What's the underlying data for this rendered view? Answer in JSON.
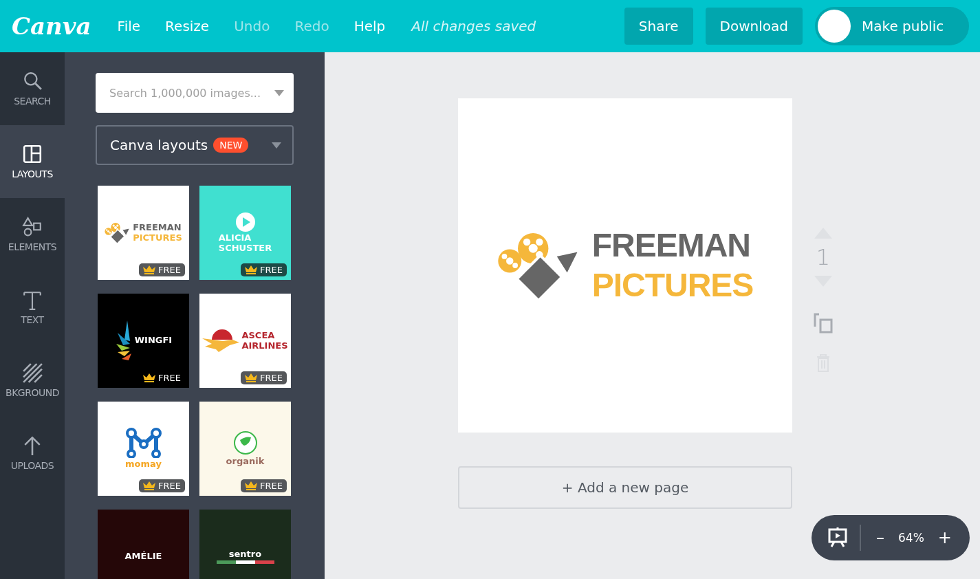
{
  "topbar": {
    "logo": "Canva",
    "menu": [
      {
        "label": "File",
        "disabled": false
      },
      {
        "label": "Resize",
        "disabled": false
      },
      {
        "label": "Undo",
        "disabled": true
      },
      {
        "label": "Redo",
        "disabled": true
      },
      {
        "label": "Help",
        "disabled": false
      }
    ],
    "status": "All changes saved",
    "buttons": [
      "Share",
      "Download"
    ],
    "toggle": {
      "label": "Make public",
      "on": false
    }
  },
  "sidebar": {
    "items": [
      {
        "label": "SEARCH",
        "selected": false
      },
      {
        "label": "LAYOUTS",
        "selected": true
      },
      {
        "label": "ELEMENTS",
        "selected": false
      },
      {
        "label": "TEXT",
        "selected": false
      },
      {
        "label": "BKGROUND",
        "selected": false
      },
      {
        "label": "UPLOADS",
        "selected": false
      }
    ]
  },
  "panel": {
    "search": {
      "placeholder": "Search 1,000,000 images..."
    },
    "dropdown": {
      "label": "Canva layouts",
      "badge": "NEW"
    },
    "templates": [
      {
        "kind": "film",
        "color": "#ffffff",
        "lines": [
          {
            "text": "FREEMAN",
            "color": "#666666"
          },
          {
            "text": "PICTURES",
            "color": "#f5b73b"
          }
        ],
        "badge": {
          "label": "FREE",
          "kind": "grey"
        }
      },
      {
        "kind": "play",
        "color": "#40e0d0",
        "lines": [
          {
            "text": "ALICIA",
            "color": "#ffffff"
          },
          {
            "text": "SCHUSTER",
            "color": "#ffffff"
          }
        ],
        "badge": {
          "label": "FREE",
          "kind": "dark"
        }
      },
      {
        "kind": "wing",
        "color": "#000000",
        "lines": [
          {
            "text": "WINGFI",
            "color": "#ffffff"
          }
        ],
        "badge": {
          "label": "FREE",
          "kind": "plain"
        }
      },
      {
        "kind": "bird",
        "color": "#ffffff",
        "lines": [
          {
            "text": "ASCEA",
            "color": "#b5262e"
          },
          {
            "text": "AIRLINES",
            "color": "#b5262e"
          }
        ],
        "badge": {
          "label": "FREE",
          "kind": "grey"
        }
      },
      {
        "kind": "m",
        "color": "#ffffff",
        "lines": [
          {
            "text": "momay",
            "color": "#f5a623"
          }
        ],
        "badge": {
          "label": "FREE",
          "kind": "grey"
        }
      },
      {
        "kind": "leaf",
        "color": "#fcf8ea",
        "lines": [
          {
            "text": "organik",
            "color": "#9a6a5e"
          }
        ],
        "badge": {
          "label": "FREE",
          "kind": "grey"
        }
      },
      {
        "kind": "plain",
        "color": "#250708",
        "lines": [
          {
            "text": "AMÉLIE",
            "color": "#ffffff"
          }
        ]
      },
      {
        "kind": "flag",
        "color": "#1b2c1c",
        "lines": [
          {
            "text": "sentro",
            "color": "#ffffff"
          }
        ]
      }
    ]
  },
  "design": {
    "lines": [
      {
        "text": "FREEMAN",
        "color": "#666666"
      },
      {
        "text": "PICTURES",
        "color": "#f5b73b"
      }
    ],
    "add_page": "+ Add a new page"
  },
  "page_tools": {
    "page_number": "1"
  },
  "zoom": {
    "value": "64%",
    "minus": "–",
    "plus": "+"
  }
}
